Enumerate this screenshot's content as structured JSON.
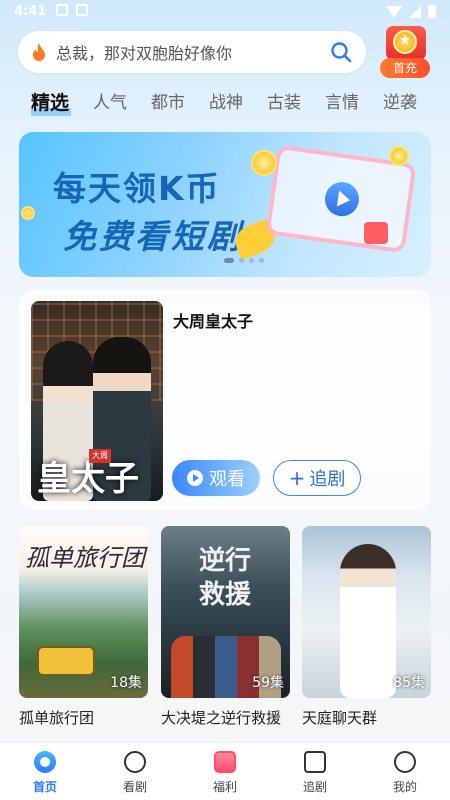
{
  "status": {
    "time": "4:41"
  },
  "search": {
    "placeholder": "总裁，那对双胞胎好像你"
  },
  "recharge": {
    "label": "首充"
  },
  "tabs": [
    "精选",
    "人气",
    "都市",
    "战神",
    "古装",
    "言情",
    "逆袭"
  ],
  "banner": {
    "line1": "每天领K币",
    "line2": "免费看短剧",
    "page_count": 4,
    "current_page": 1
  },
  "featured": {
    "title": "大周皇太子",
    "poster_text": "皇太子",
    "poster_seal": "大周",
    "watch_label": "观看",
    "follow_label": "追剧"
  },
  "cards": [
    {
      "title": "孤单旅行团",
      "episodes": "18集",
      "poster_text": "孤单旅行团"
    },
    {
      "title": "大决堤之逆行救援",
      "episodes": "59集",
      "poster_text": "逆行救援"
    },
    {
      "title": "天庭聊天群",
      "episodes": "85集"
    }
  ],
  "nav": [
    {
      "label": "首页",
      "icon": "home-icon",
      "active": true
    },
    {
      "label": "看剧",
      "icon": "play-circle-icon"
    },
    {
      "label": "福利",
      "icon": "gift-icon"
    },
    {
      "label": "追剧",
      "icon": "folder-star-icon"
    },
    {
      "label": "我的",
      "icon": "profile-icon"
    }
  ],
  "colors": {
    "accent": "#2a7bff",
    "banner_text": "#1666b8",
    "recharge": "#ff4d2c"
  }
}
